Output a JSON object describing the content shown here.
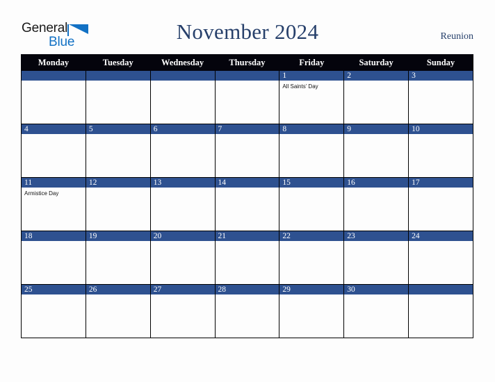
{
  "logo": {
    "text_top": "General",
    "text_bottom": "Blue",
    "color_top": "#1a1a1a",
    "color_bottom": "#1271c4"
  },
  "header": {
    "title": "November 2024",
    "country": "Reunion",
    "title_color": "#27406b"
  },
  "colors": {
    "header_row_bg": "#04040c",
    "daynum_band": "#2e5190",
    "cell_bg": "#fdfdfd",
    "page_bg": "#fdfdfd",
    "grid_line": "#000000"
  },
  "weekday_headers": [
    "Monday",
    "Tuesday",
    "Wednesday",
    "Thursday",
    "Friday",
    "Saturday",
    "Sunday"
  ],
  "weeks": [
    [
      {
        "day": "",
        "event": ""
      },
      {
        "day": "",
        "event": ""
      },
      {
        "day": "",
        "event": ""
      },
      {
        "day": "",
        "event": ""
      },
      {
        "day": "1",
        "event": "All Saints’ Day"
      },
      {
        "day": "2",
        "event": ""
      },
      {
        "day": "3",
        "event": ""
      }
    ],
    [
      {
        "day": "4",
        "event": ""
      },
      {
        "day": "5",
        "event": ""
      },
      {
        "day": "6",
        "event": ""
      },
      {
        "day": "7",
        "event": ""
      },
      {
        "day": "8",
        "event": ""
      },
      {
        "day": "9",
        "event": ""
      },
      {
        "day": "10",
        "event": ""
      }
    ],
    [
      {
        "day": "11",
        "event": "Armistice Day"
      },
      {
        "day": "12",
        "event": ""
      },
      {
        "day": "13",
        "event": ""
      },
      {
        "day": "14",
        "event": ""
      },
      {
        "day": "15",
        "event": ""
      },
      {
        "day": "16",
        "event": ""
      },
      {
        "day": "17",
        "event": ""
      }
    ],
    [
      {
        "day": "18",
        "event": ""
      },
      {
        "day": "19",
        "event": ""
      },
      {
        "day": "20",
        "event": ""
      },
      {
        "day": "21",
        "event": ""
      },
      {
        "day": "22",
        "event": ""
      },
      {
        "day": "23",
        "event": ""
      },
      {
        "day": "24",
        "event": ""
      }
    ],
    [
      {
        "day": "25",
        "event": ""
      },
      {
        "day": "26",
        "event": ""
      },
      {
        "day": "27",
        "event": ""
      },
      {
        "day": "28",
        "event": ""
      },
      {
        "day": "29",
        "event": ""
      },
      {
        "day": "30",
        "event": ""
      },
      {
        "day": "",
        "event": ""
      }
    ]
  ]
}
